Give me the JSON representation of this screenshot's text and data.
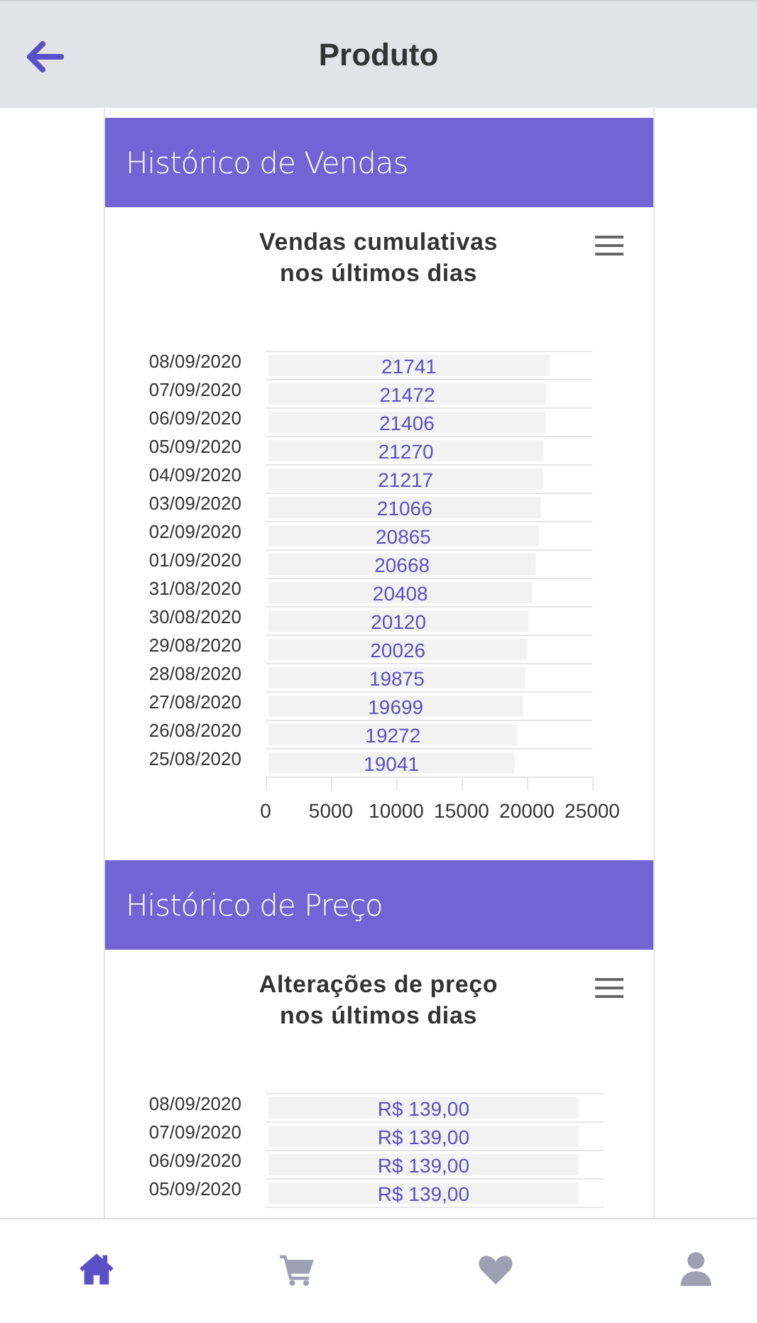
{
  "header": {
    "title": "Produto"
  },
  "sections": [
    {
      "title": "Histórico de Vendas",
      "chart_data": {
        "type": "bar",
        "orientation": "horizontal",
        "title": "Vendas cumulativas nos últimos dias",
        "data_labels": true,
        "xlim": [
          0,
          25000
        ],
        "xticks": [
          0,
          5000,
          10000,
          15000,
          20000,
          25000
        ],
        "categories": [
          "08/09/2020",
          "07/09/2020",
          "06/09/2020",
          "05/09/2020",
          "04/09/2020",
          "03/09/2020",
          "02/09/2020",
          "01/09/2020",
          "31/08/2020",
          "30/08/2020",
          "29/08/2020",
          "28/08/2020",
          "27/08/2020",
          "26/08/2020",
          "25/08/2020"
        ],
        "values": [
          21741,
          21472,
          21406,
          21270,
          21217,
          21066,
          20865,
          20668,
          20408,
          20120,
          20026,
          19875,
          19699,
          19272,
          19041
        ]
      }
    },
    {
      "title": "Histórico de Preço",
      "chart_data": {
        "type": "bar",
        "orientation": "horizontal",
        "title": "Alterações de preço nos últimos dias",
        "data_labels": true,
        "categories": [
          "08/09/2020",
          "07/09/2020",
          "06/09/2020",
          "05/09/2020"
        ],
        "values": [
          139,
          139,
          139,
          139
        ],
        "value_labels": [
          "R$ 139,00",
          "R$ 139,00",
          "R$ 139,00",
          "R$ 139,00"
        ]
      }
    }
  ],
  "nav": [
    {
      "kind": "home",
      "selected": true
    },
    {
      "kind": "cart",
      "selected": false
    },
    {
      "kind": "heart",
      "selected": false
    },
    {
      "kind": "user",
      "selected": false
    }
  ]
}
